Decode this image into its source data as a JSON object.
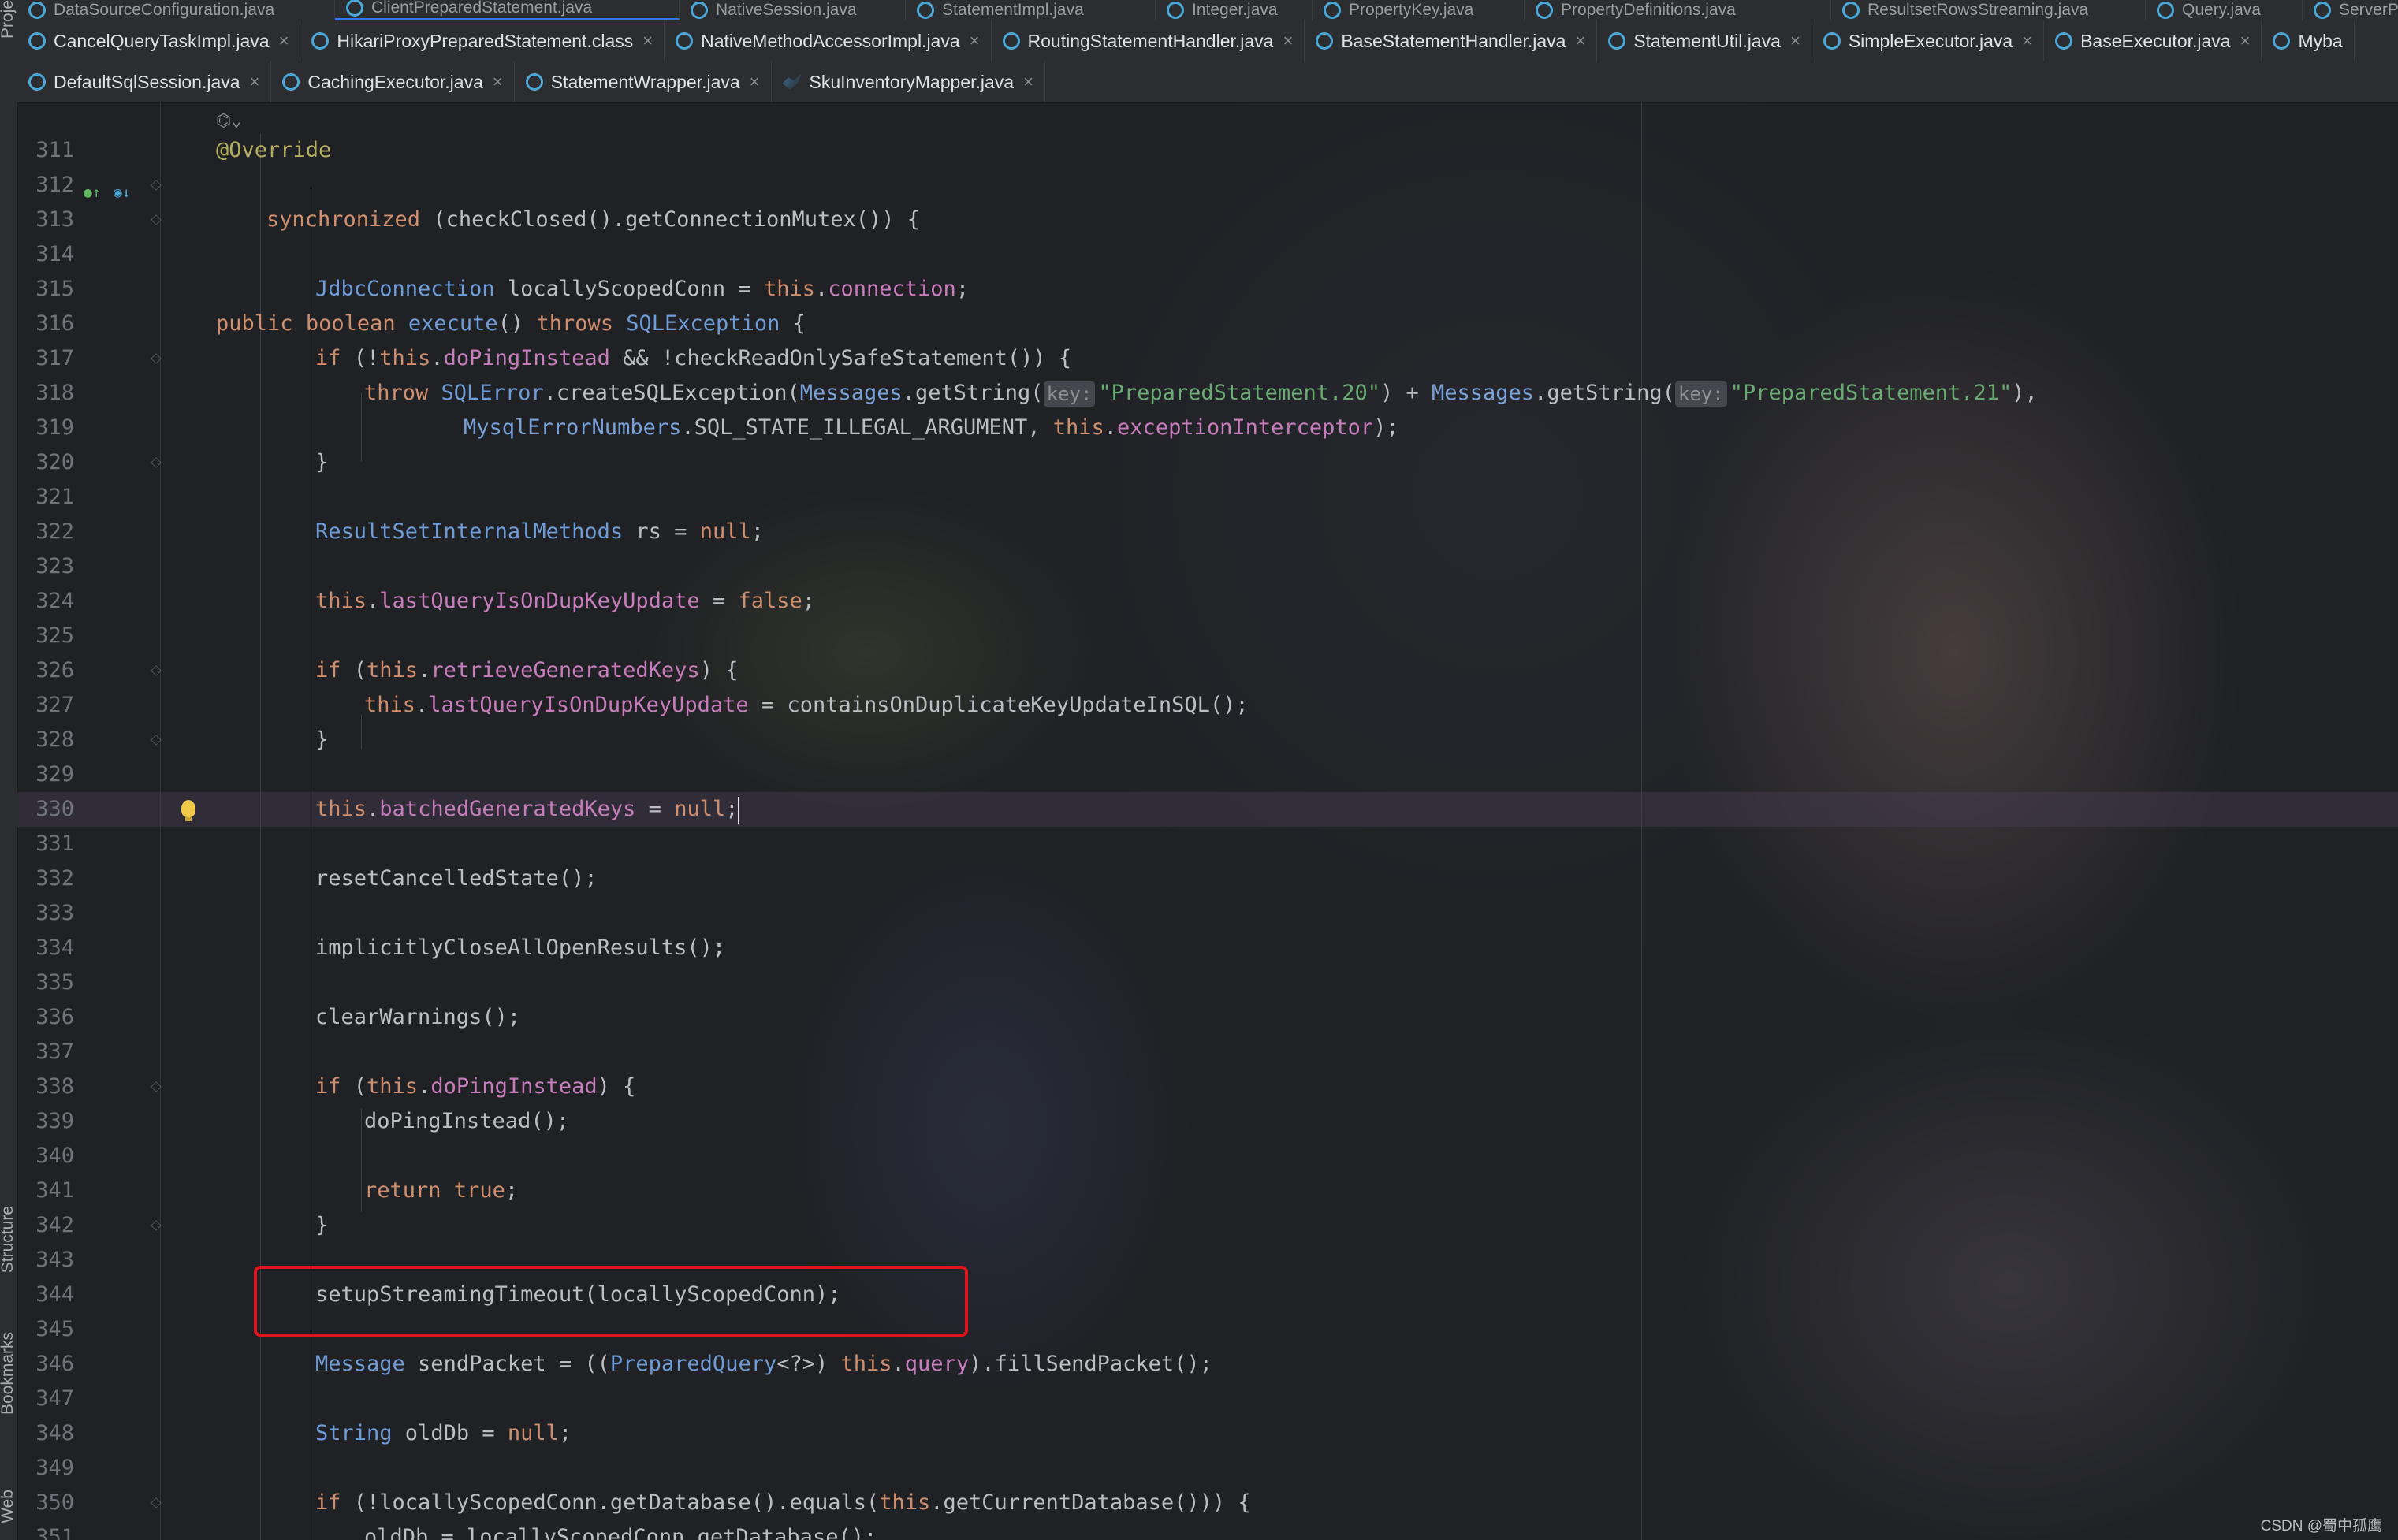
{
  "sidebar": {
    "project_label": "Proje",
    "structure_label": "Structure",
    "bookmarks_label": "Bookmarks",
    "web_label": "Web"
  },
  "tabs_row0": [
    "DataSourceConfiguration.java",
    "ClientPreparedStatement.java",
    "NativeSession.java",
    "StatementImpl.java",
    "Integer.java",
    "PropertyKey.java",
    "PropertyDefinitions.java",
    "ResultsetRowsStreaming.java",
    "Query.java",
    "ServerPrepar"
  ],
  "tabs_row1": [
    "CancelQueryTaskImpl.java",
    "HikariProxyPreparedStatement.class",
    "NativeMethodAccessorImpl.java",
    "RoutingStatementHandler.java",
    "BaseStatementHandler.java",
    "StatementUtil.java",
    "SimpleExecutor.java",
    "BaseExecutor.java",
    "Myba"
  ],
  "tabs_row2": [
    "DefaultSqlSession.java",
    "CachingExecutor.java",
    "StatementWrapper.java",
    "SkuInventoryMapper.java"
  ],
  "line_numbers": [
    "311",
    "312",
    "313",
    "314",
    "315",
    "316",
    "317",
    "318",
    "319",
    "320",
    "321",
    "322",
    "323",
    "324",
    "325",
    "326",
    "327",
    "328",
    "329",
    "330",
    "331",
    "332",
    "333",
    "334",
    "335",
    "336",
    "337",
    "338",
    "339",
    "340",
    "341",
    "342",
    "343",
    "344",
    "345",
    "346",
    "347",
    "348",
    "349",
    "350",
    "351"
  ],
  "code": {
    "l311": "@Override",
    "l312": [
      "public",
      "boolean",
      "execute",
      "() ",
      "throws",
      "SQLException",
      " {"
    ],
    "l313": [
      "synchronized",
      " (checkClosed().getConnectionMutex()) {"
    ],
    "l315": [
      "JdbcConnection",
      " locallyScopedConn = ",
      "this",
      ".",
      "connection",
      ";"
    ],
    "l317": [
      "if",
      " (!",
      "this",
      ".",
      "doPingInstead",
      " && !checkReadOnlySafeStatement()) {"
    ],
    "l318": [
      "throw",
      "SQLError",
      ".createSQLException(",
      "Messages",
      ".getString(",
      "key:",
      "\"PreparedStatement.20\"",
      ") + ",
      "Messages",
      ".getString(",
      "key:",
      "\"PreparedStatement.21\"",
      "),"
    ],
    "l319": [
      "MysqlErrorNumbers",
      ".SQL_STATE_ILLEGAL_ARGUMENT, ",
      "this",
      ".",
      "exceptionInterceptor",
      ");"
    ],
    "l320": "}",
    "l322": [
      "ResultSetInternalMethods",
      " rs = ",
      "null",
      ";"
    ],
    "l324": [
      "this",
      ".",
      "lastQueryIsOnDupKeyUpdate",
      " = ",
      "false",
      ";"
    ],
    "l326": [
      "if",
      " (",
      "this",
      ".",
      "retrieveGeneratedKeys",
      ") {"
    ],
    "l327": [
      "this",
      ".",
      "lastQueryIsOnDupKeyUpdate",
      " = containsOnDuplicateKeyUpdateInSQL();"
    ],
    "l328": "}",
    "l330": [
      "this",
      ".",
      "batchedGeneratedKeys",
      " = ",
      "null",
      ";"
    ],
    "l332": "resetCancelledState();",
    "l334": "implicitlyCloseAllOpenResults();",
    "l336": "clearWarnings();",
    "l338": [
      "if",
      " (",
      "this",
      ".",
      "doPingInstead",
      ") {"
    ],
    "l339": "doPingInstead();",
    "l341": [
      "return",
      " ",
      "true",
      ";"
    ],
    "l342": "}",
    "l344": "setupStreamingTimeout(locallyScopedConn);",
    "l346": [
      "Message",
      " sendPacket = ((",
      "PreparedQuery",
      "<?>) ",
      "this",
      ".",
      "query",
      ").fillSendPacket();"
    ],
    "l348": [
      "String",
      " oldDb = ",
      "null",
      ";"
    ],
    "l350": [
      "if",
      " (!locallyScopedConn.getDatabase().equals(",
      "this",
      ".getCurrentDatabase())) {"
    ],
    "l351": "oldDb = locallyScopedConn.getDatabase();"
  },
  "watermark": "CSDN @蜀中孤鹰",
  "colors": {
    "keyword": "#cf8e6d",
    "type": "#6f9bd6",
    "field": "#c77dbb",
    "string": "#6aab73",
    "annotation": "#b3ae60",
    "highlight_box": "#e0141c"
  }
}
